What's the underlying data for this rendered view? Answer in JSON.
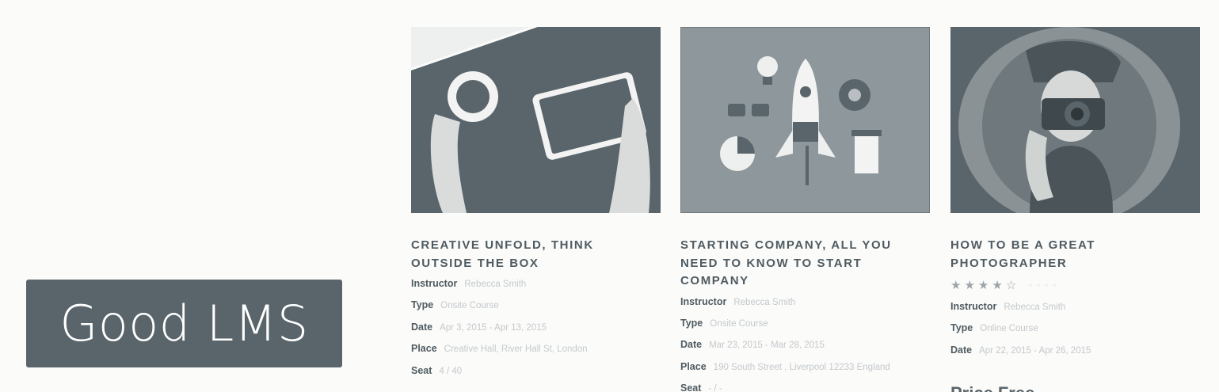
{
  "brand": {
    "name": "Good LMS"
  },
  "courses": [
    {
      "title": "CREATIVE UNFOLD, THINK OUTSIDE THE BOX",
      "image_icon": "tablet-coffee-icon",
      "meta": [
        {
          "label": "Instructor",
          "value": "Rebecca Smith"
        },
        {
          "label": "Type",
          "value": "Onsite Course"
        },
        {
          "label": "Date",
          "value": "Apr 3, 2015 - Apr 13, 2015"
        },
        {
          "label": "Place",
          "value": "Creative Hall, River Hall St, London"
        },
        {
          "label": "Seat",
          "value": "4 / 40"
        }
      ]
    },
    {
      "title": "STARTING COMPANY, ALL YOU NEED TO KNOW TO START COMPANY",
      "image_icon": "rocket-startup-icon",
      "meta": [
        {
          "label": "Instructor",
          "value": "Rebecca Smith"
        },
        {
          "label": "Type",
          "value": "Onsite Course"
        },
        {
          "label": "Date",
          "value": "Mar 23, 2015 - Mar 28, 2015"
        },
        {
          "label": "Place",
          "value": "190 South Street , Liverpool 12233 England"
        },
        {
          "label": "Seat",
          "value": "- / -"
        }
      ]
    },
    {
      "title": "HOW TO BE A GREAT PHOTOGRAPHER",
      "image_icon": "photographer-camera-icon",
      "rating": {
        "value": 4,
        "max": 5,
        "count_text": "- - - -"
      },
      "meta": [
        {
          "label": "Instructor",
          "value": "Rebecca Smith"
        },
        {
          "label": "Type",
          "value": "Online Course"
        },
        {
          "label": "Date",
          "value": "Apr 22, 2015 - Apr 26, 2015"
        }
      ],
      "price_label": "Price",
      "price_value": "Free"
    }
  ],
  "colors": {
    "slate": "#59656b",
    "background": "#fbfbfa",
    "muted_text": "#c4c9cb"
  }
}
